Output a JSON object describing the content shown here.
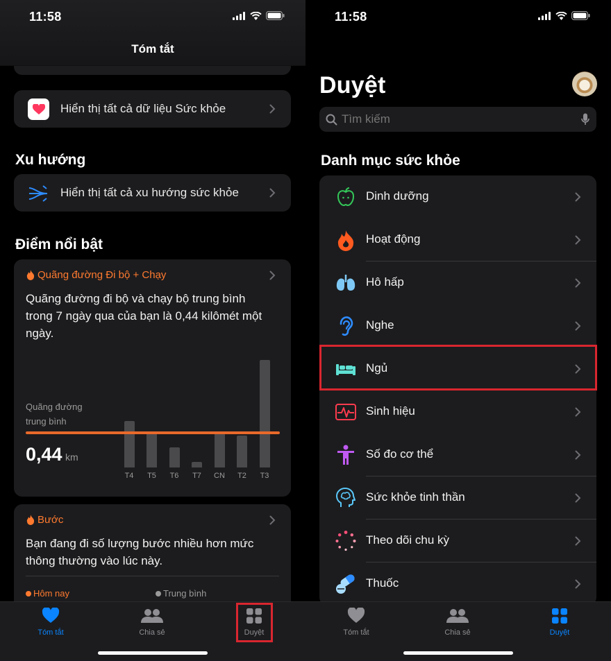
{
  "status": {
    "time": "11:58"
  },
  "summary_screen": {
    "nav_title": "Tóm tắt",
    "show_all_data": "Hiển thị tất cả dữ liệu Sức khỏe",
    "trends_title": "Xu hướng",
    "show_all_trends": "Hiển thị tất cả xu hướng sức khỏe",
    "highlights_title": "Điểm nổi bật",
    "walking_card": {
      "title": "Quãng đường Đi bộ + Chạy",
      "text": "Quãng đường đi bộ và chạy bộ trung bình trong 7 ngày qua của bạn là 0,44 kilômét một ngày.",
      "avg_label_1": "Quãng đường",
      "avg_label_2": "trung bình",
      "avg_value": "0,44",
      "avg_unit": "km"
    },
    "steps_card": {
      "title": "Bước",
      "text": "Bạn đang đi số lượng bước nhiều hơn mức thông thường vào lúc này.",
      "legend_today": "Hôm nay",
      "legend_avg": "Trung bình"
    }
  },
  "chart_data": {
    "type": "bar",
    "categories": [
      "T4",
      "T5",
      "T6",
      "T7",
      "CN",
      "T2",
      "T3"
    ],
    "values": [
      0.16,
      0.12,
      0.07,
      0.02,
      0.12,
      0.11,
      0.37
    ],
    "average": 0.44,
    "average_color": "#e8692a",
    "bar_color": "#4a4a4c"
  },
  "browse_screen": {
    "title": "Duyệt",
    "search_placeholder": "Tìm kiếm",
    "categories_title": "Danh mục sức khỏe",
    "categories": [
      {
        "label": "Dinh dưỡng",
        "icon": "apple-icon"
      },
      {
        "label": "Hoạt động",
        "icon": "flame-icon"
      },
      {
        "label": "Hô hấp",
        "icon": "lungs-icon"
      },
      {
        "label": "Nghe",
        "icon": "ear-icon"
      },
      {
        "label": "Ngủ",
        "icon": "bed-icon"
      },
      {
        "label": "Sinh hiệu",
        "icon": "vitals-icon"
      },
      {
        "label": "Số đo cơ thể",
        "icon": "figure-icon"
      },
      {
        "label": "Sức khỏe tinh thần",
        "icon": "head-icon"
      },
      {
        "label": "Theo dõi chu kỳ",
        "icon": "cycle-icon"
      },
      {
        "label": "Thuốc",
        "icon": "pill-icon"
      }
    ]
  },
  "tab_bar": {
    "summary": "Tóm tắt",
    "sharing": "Chia sẻ",
    "browse": "Duyệt"
  },
  "colors": {
    "accent": "#0a84ff",
    "highlight_orange": "#ff7a2f",
    "annotation_red": "#d9262f"
  }
}
